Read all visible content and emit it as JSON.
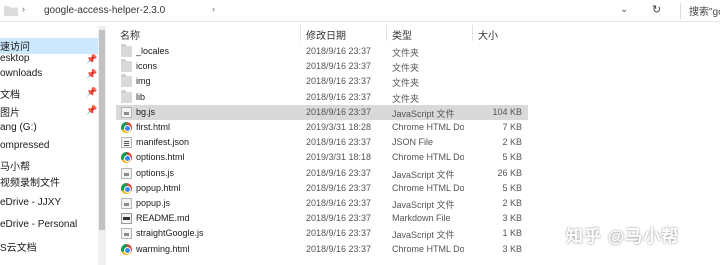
{
  "address_bar": {
    "separator_1": "›",
    "path": "google-access-helper-2.3.0",
    "separator_2": "›",
    "dropdown_glyph": "⌄",
    "refresh_glyph": "↻",
    "search_placeholder": "搜索\"go"
  },
  "nav": {
    "items": [
      {
        "label": "速访问",
        "active": true,
        "pinned": false
      },
      {
        "label": "esktop",
        "active": false,
        "pinned": true
      },
      {
        "label": "ownloads",
        "active": false,
        "pinned": true
      },
      {
        "label": "文档",
        "active": false,
        "pinned": true
      },
      {
        "label": "图片",
        "active": false,
        "pinned": true
      },
      {
        "label": "ang (G:)",
        "active": false,
        "pinned": false
      },
      {
        "label": "ompressed",
        "active": false,
        "pinned": false
      },
      {
        "label": "马小帮",
        "active": false,
        "pinned": false
      },
      {
        "label": "视频录制文件",
        "active": false,
        "pinned": false
      },
      {
        "label": "eDrive - JJXY",
        "active": false,
        "pinned": false
      },
      {
        "label": "eDrive - Personal",
        "active": false,
        "pinned": false
      },
      {
        "label": "S云文档",
        "active": false,
        "pinned": false
      }
    ],
    "pin_glyph": "📌"
  },
  "columns": {
    "name": "名称",
    "modified": "修改日期",
    "type": "类型",
    "size": "大小"
  },
  "files": [
    {
      "name": "_locales",
      "date": "2018/9/16 23:37",
      "type": "文件夹",
      "size": "",
      "icon": "folder-icon"
    },
    {
      "name": "icons",
      "date": "2018/9/16 23:37",
      "type": "文件夹",
      "size": "",
      "icon": "folder-icon"
    },
    {
      "name": "img",
      "date": "2018/9/16 23:37",
      "type": "文件夹",
      "size": "",
      "icon": "folder-icon"
    },
    {
      "name": "lib",
      "date": "2018/9/16 23:37",
      "type": "文件夹",
      "size": "",
      "icon": "folder-icon"
    },
    {
      "name": "bg.js",
      "date": "2018/9/16 23:37",
      "type": "JavaScript 文件",
      "size": "104 KB",
      "icon": "js-file-icon",
      "selected": true
    },
    {
      "name": "first.html",
      "date": "2019/3/31 18:28",
      "type": "Chrome HTML Do...",
      "size": "7 KB",
      "icon": "chrome-icon"
    },
    {
      "name": "manifest.json",
      "date": "2018/9/16 23:37",
      "type": "JSON File",
      "size": "2 KB",
      "icon": "json-file-icon"
    },
    {
      "name": "options.html",
      "date": "2019/3/31 18:18",
      "type": "Chrome HTML Do...",
      "size": "5 KB",
      "icon": "chrome-icon"
    },
    {
      "name": "options.js",
      "date": "2018/9/16 23:37",
      "type": "JavaScript 文件",
      "size": "26 KB",
      "icon": "js-file-icon"
    },
    {
      "name": "popup.html",
      "date": "2018/9/16 23:37",
      "type": "Chrome HTML Do...",
      "size": "5 KB",
      "icon": "chrome-icon"
    },
    {
      "name": "popup.js",
      "date": "2018/9/16 23:37",
      "type": "JavaScript 文件",
      "size": "2 KB",
      "icon": "js-file-icon"
    },
    {
      "name": "README.md",
      "date": "2018/9/16 23:37",
      "type": "Markdown File",
      "size": "3 KB",
      "icon": "md-file-icon"
    },
    {
      "name": "straightGoogle.js",
      "date": "2018/9/16 23:37",
      "type": "JavaScript 文件",
      "size": "1 KB",
      "icon": "js-file-icon"
    },
    {
      "name": "warming.html",
      "date": "2018/9/16 23:37",
      "type": "Chrome HTML Do...",
      "size": "3 KB",
      "icon": "chrome-icon"
    }
  ],
  "watermark": "知乎 @马小帮"
}
